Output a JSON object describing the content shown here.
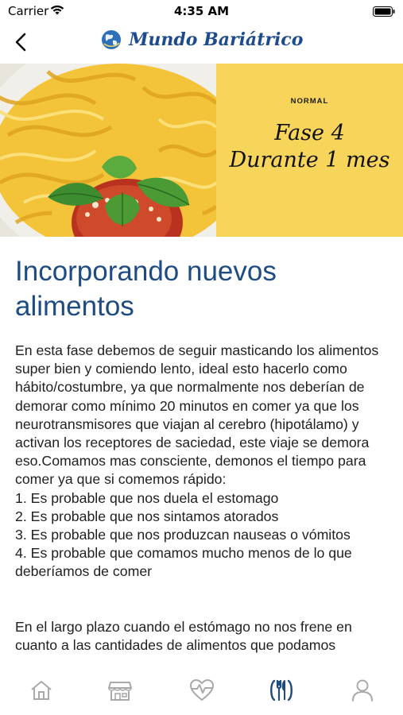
{
  "status_bar": {
    "carrier": "Carrier",
    "time": "4:35 AM",
    "wifi_icon": "wifi-icon",
    "battery_icon": "battery-icon"
  },
  "nav": {
    "back_icon": "chevron-left-icon",
    "title": "Mundo Bariátrico",
    "logo_icon": "globe-icon",
    "title_color": "#1d4b8f"
  },
  "hero": {
    "tag": "NORMAL",
    "phase": "Fase 4",
    "duration": "Durante 1 mes",
    "panel_color": "#f7d45a"
  },
  "article": {
    "title": "Incorporando nuevos alimentos",
    "intro": "En esta fase debemos de seguir masticando los alimentos super bien y comiendo lento, ideal esto hacerlo como hábito/costumbre, ya que normalmente nos deberían de demorar como mínimo 20 minutos en comer ya que los  neurotransmisores que viajan al cerebro (hipotálamo) y activan los receptores de saciedad, este viaje se demora eso.Comamos mas consciente, demonos el tiempo para comer ya que si comemos rápido:",
    "list": [
      "1. Es probable que nos duela el estomago",
      "2. Es probable que nos sintamos atorados",
      "3. Es probable que nos produzcan nauseas o vómitos",
      "4. Es probable que comamos mucho menos de lo que deberíamos de comer"
    ],
    "closing": "En el largo plazo cuando el estómago no nos frene en cuanto a las cantidades de alimentos que podamos"
  },
  "tab_bar": {
    "items": [
      {
        "icon": "home-icon",
        "active": false
      },
      {
        "icon": "store-icon",
        "active": false
      },
      {
        "icon": "heartbeat-icon",
        "active": false
      },
      {
        "icon": "restaurant-icon",
        "active": true
      },
      {
        "icon": "profile-icon",
        "active": false
      }
    ],
    "active_color": "#1d4b82",
    "inactive_color": "#a9a9a9"
  }
}
